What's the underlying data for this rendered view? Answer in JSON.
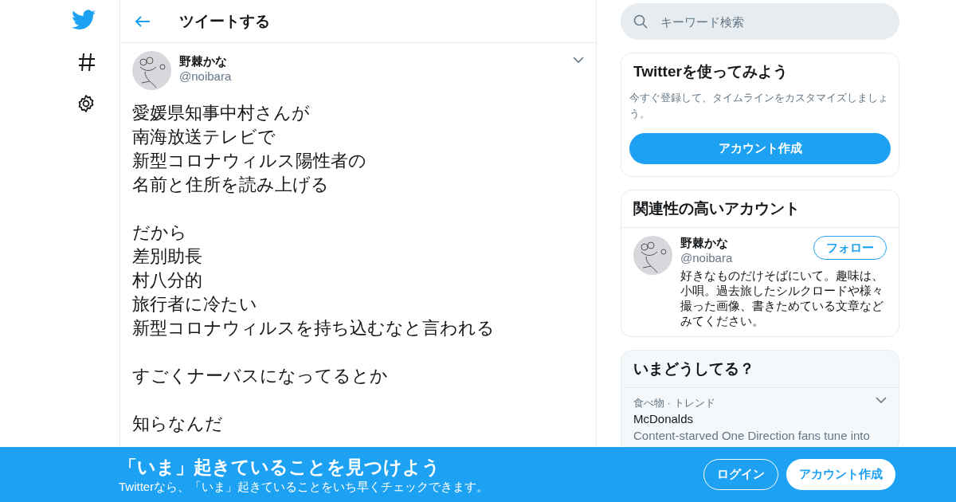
{
  "header": {
    "title": "ツイートする"
  },
  "tweet": {
    "name": "野棘かな",
    "handle": "@noibara",
    "paragraphs": [
      [
        "愛媛県知事中村さんが",
        "南海放送テレビで",
        "新型コロナウィルス陽性者の",
        "名前と住所を読み上げる"
      ],
      [
        "だから",
        "差別助長",
        "村八分的",
        "旅行者に冷たい",
        "新型コロナウィルスを持ち込むなと言われる"
      ],
      [
        "すごくナーバスになってるとか"
      ],
      [
        "知らなんだ"
      ]
    ]
  },
  "search": {
    "placeholder": "キーワード検索"
  },
  "signup_card": {
    "title": "Twitterを使ってみよう",
    "text": "今すぐ登録して、タイムラインをカスタマイズしましょう。",
    "button": "アカウント作成"
  },
  "related": {
    "title": "関連性の高いアカウント",
    "accounts": [
      {
        "name": "野棘かな",
        "handle": "@noibara",
        "button": "フォロー",
        "bio": "好きなものだけそばにいて。趣味は、小唄。過去旅したシルクロードや様々撮った画像、書きためている文章などみてください。"
      }
    ]
  },
  "trends": {
    "title": "いまどうしてる？",
    "items": [
      {
        "category": "食べ物 · トレンド",
        "name": "McDonalds",
        "description": "Content-starved One Direction fans tune into"
      }
    ]
  },
  "banner": {
    "title": "「いま」起きていることを見つけよう",
    "text": "Twitterなら、「いま」起きていることをいち早くチェックできます。",
    "login": "ログイン",
    "signup": "アカウント作成"
  }
}
